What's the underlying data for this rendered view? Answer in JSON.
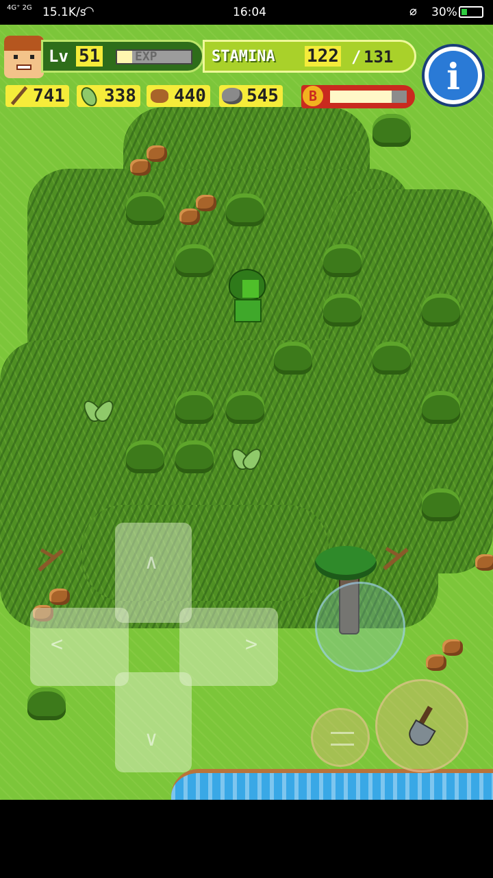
{
  "status_bar": {
    "signal": "4G⁺ 2G",
    "network_speed": "15.1K/s",
    "time": "16:04",
    "battery_percent": "30%",
    "battery_level": 0.3,
    "icons": [
      "signal-icon",
      "wifi-icon",
      "notifications-muted-icon",
      "battery-icon"
    ]
  },
  "hud": {
    "level_label": "Lv",
    "level": "51",
    "exp_label": "EXP",
    "exp_fill": 0.2,
    "stamina_label": "STAMINA",
    "stamina_current": "122",
    "stamina_separator": "/",
    "stamina_max": "131",
    "info_button": "i",
    "boost_label": "B",
    "boost_fill": 0.8
  },
  "resources": [
    {
      "name": "twigs",
      "icon": "twig-icon",
      "count": "741"
    },
    {
      "name": "leaves",
      "icon": "leaf-icon",
      "count": "338"
    },
    {
      "name": "nuts",
      "icon": "nut-icon",
      "count": "440"
    },
    {
      "name": "stones",
      "icon": "stone-icon",
      "count": "545"
    }
  ],
  "colors": {
    "grass": "#7cc63a",
    "dense_grass": "#4f8f23",
    "water": "#39a8e6",
    "level_panel": "#2e6d1a",
    "stamina_panel": "#a9d12a",
    "value_highlight": "#f5ec3a",
    "boost_panel": "#c92a1f",
    "info_button": "#2a7ad6"
  },
  "controls": {
    "dpad": [
      "up",
      "down",
      "left",
      "right"
    ],
    "joystick": "move",
    "menu_button": "menu-icon",
    "action_button": "shovel-icon"
  }
}
